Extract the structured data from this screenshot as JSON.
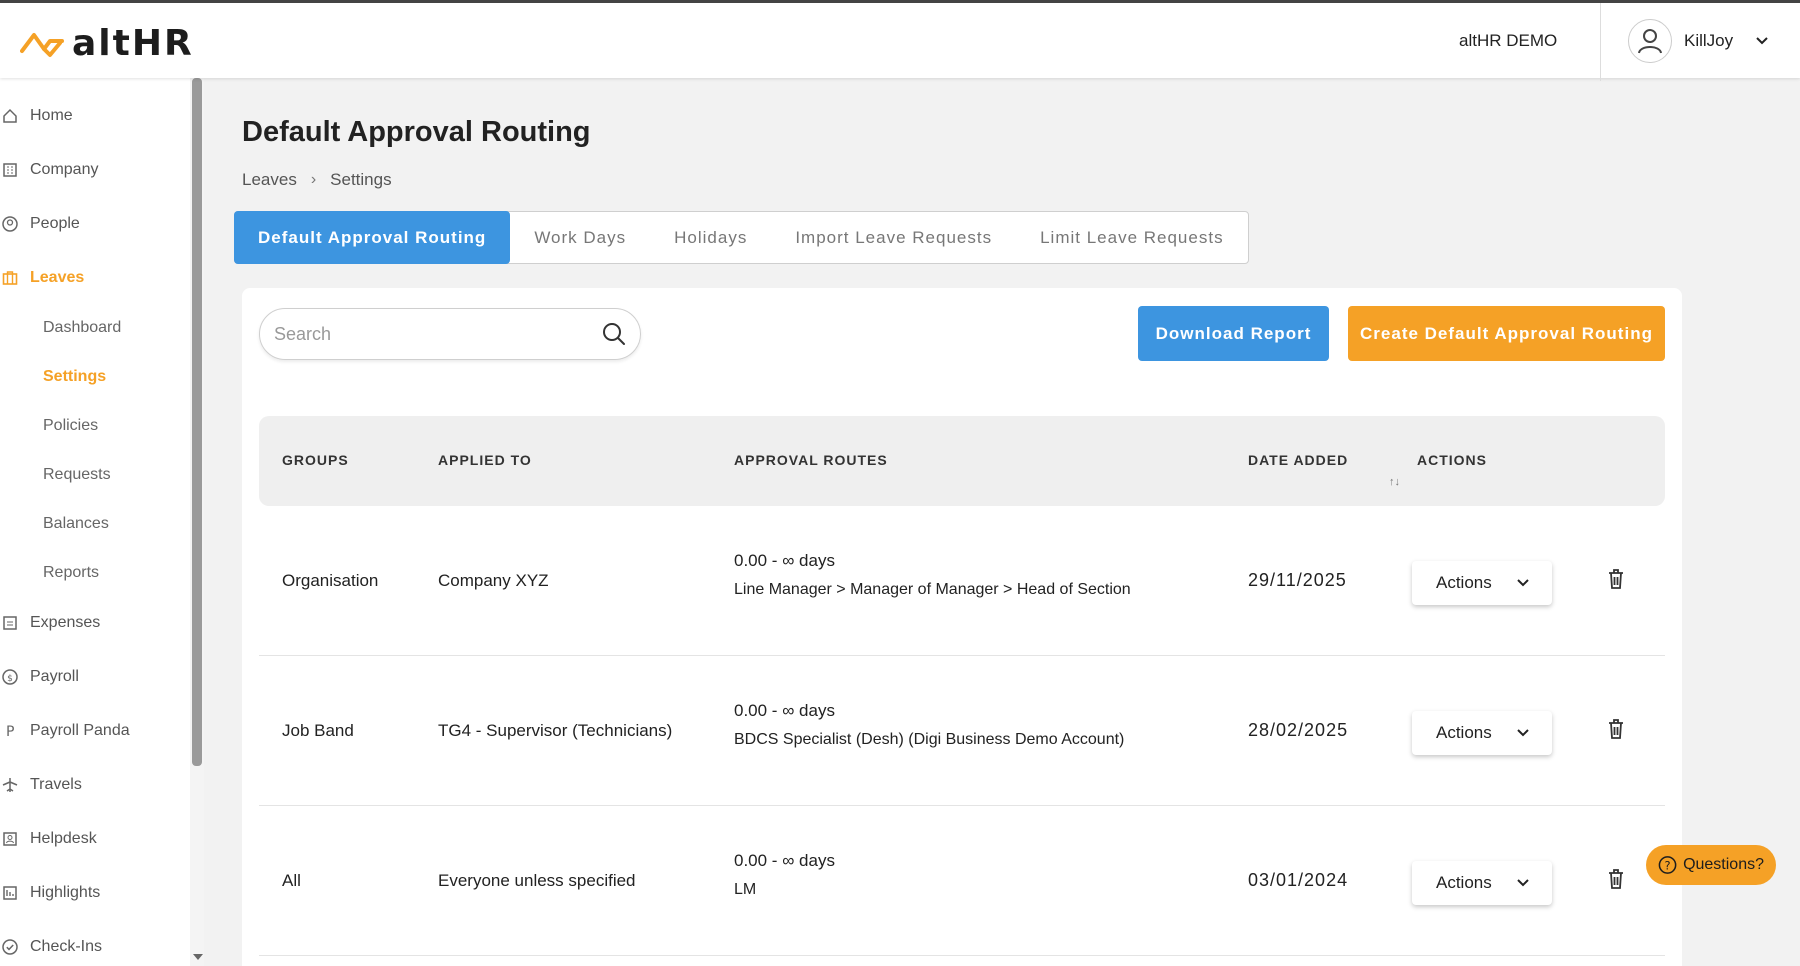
{
  "header": {
    "logo_text": "altHR",
    "company": "altHR DEMO",
    "user": "KillJoy"
  },
  "sidebar": {
    "items": [
      {
        "label": "Home",
        "icon": "home-icon"
      },
      {
        "label": "Company",
        "icon": "building-icon"
      },
      {
        "label": "People",
        "icon": "user-circle-icon"
      },
      {
        "label": "Leaves",
        "icon": "briefcase-icon"
      },
      {
        "label": "Expenses",
        "icon": "receipt-icon"
      },
      {
        "label": "Payroll",
        "icon": "dollar-icon"
      },
      {
        "label": "Payroll Panda",
        "icon": "p-icon"
      },
      {
        "label": "Travels",
        "icon": "plane-icon"
      },
      {
        "label": "Helpdesk",
        "icon": "helpdesk-icon"
      },
      {
        "label": "Highlights",
        "icon": "highlights-icon"
      },
      {
        "label": "Check-Ins",
        "icon": "check-circle-icon"
      }
    ],
    "leaves_sub": [
      "Dashboard",
      "Settings",
      "Policies",
      "Requests",
      "Balances",
      "Reports"
    ],
    "active_item": "Leaves",
    "active_sub": "Settings"
  },
  "page": {
    "title": "Default Approval Routing",
    "breadcrumb": [
      "Leaves",
      "Settings"
    ]
  },
  "tabs": [
    "Default Approval Routing",
    "Work Days",
    "Holidays",
    "Import Leave Requests",
    "Limit Leave Requests"
  ],
  "toolbar": {
    "search_placeholder": "Search",
    "download_label": "Download Report",
    "create_label": "Create Default Approval Routing"
  },
  "table": {
    "headers": [
      "GROUPS",
      "APPLIED TO",
      "APPROVAL ROUTES",
      "DATE ADDED",
      "ACTIONS"
    ],
    "sort_indicator": "↑↓",
    "rows": [
      {
        "group": "Organisation",
        "applied_to": "Company XYZ",
        "range": "0.00 - ∞ days",
        "route": "Line Manager > Manager of Manager > Head of Section",
        "date": "29/11/2025",
        "actions": "Actions"
      },
      {
        "group": "Job Band",
        "applied_to": "TG4 - Supervisor (Technicians)",
        "range": "0.00 - ∞ days",
        "route": "BDCS Specialist (Desh) (Digi Business Demo Account)",
        "date": "28/02/2025",
        "actions": "Actions"
      },
      {
        "group": "All",
        "applied_to": "Everyone unless specified",
        "range": "0.00 - ∞ days",
        "route": "LM",
        "date": "03/01/2024",
        "actions": "Actions"
      }
    ]
  },
  "help": {
    "label": "Questions?"
  },
  "colors": {
    "accent": "#f5a126",
    "primary": "#3d95e0"
  }
}
